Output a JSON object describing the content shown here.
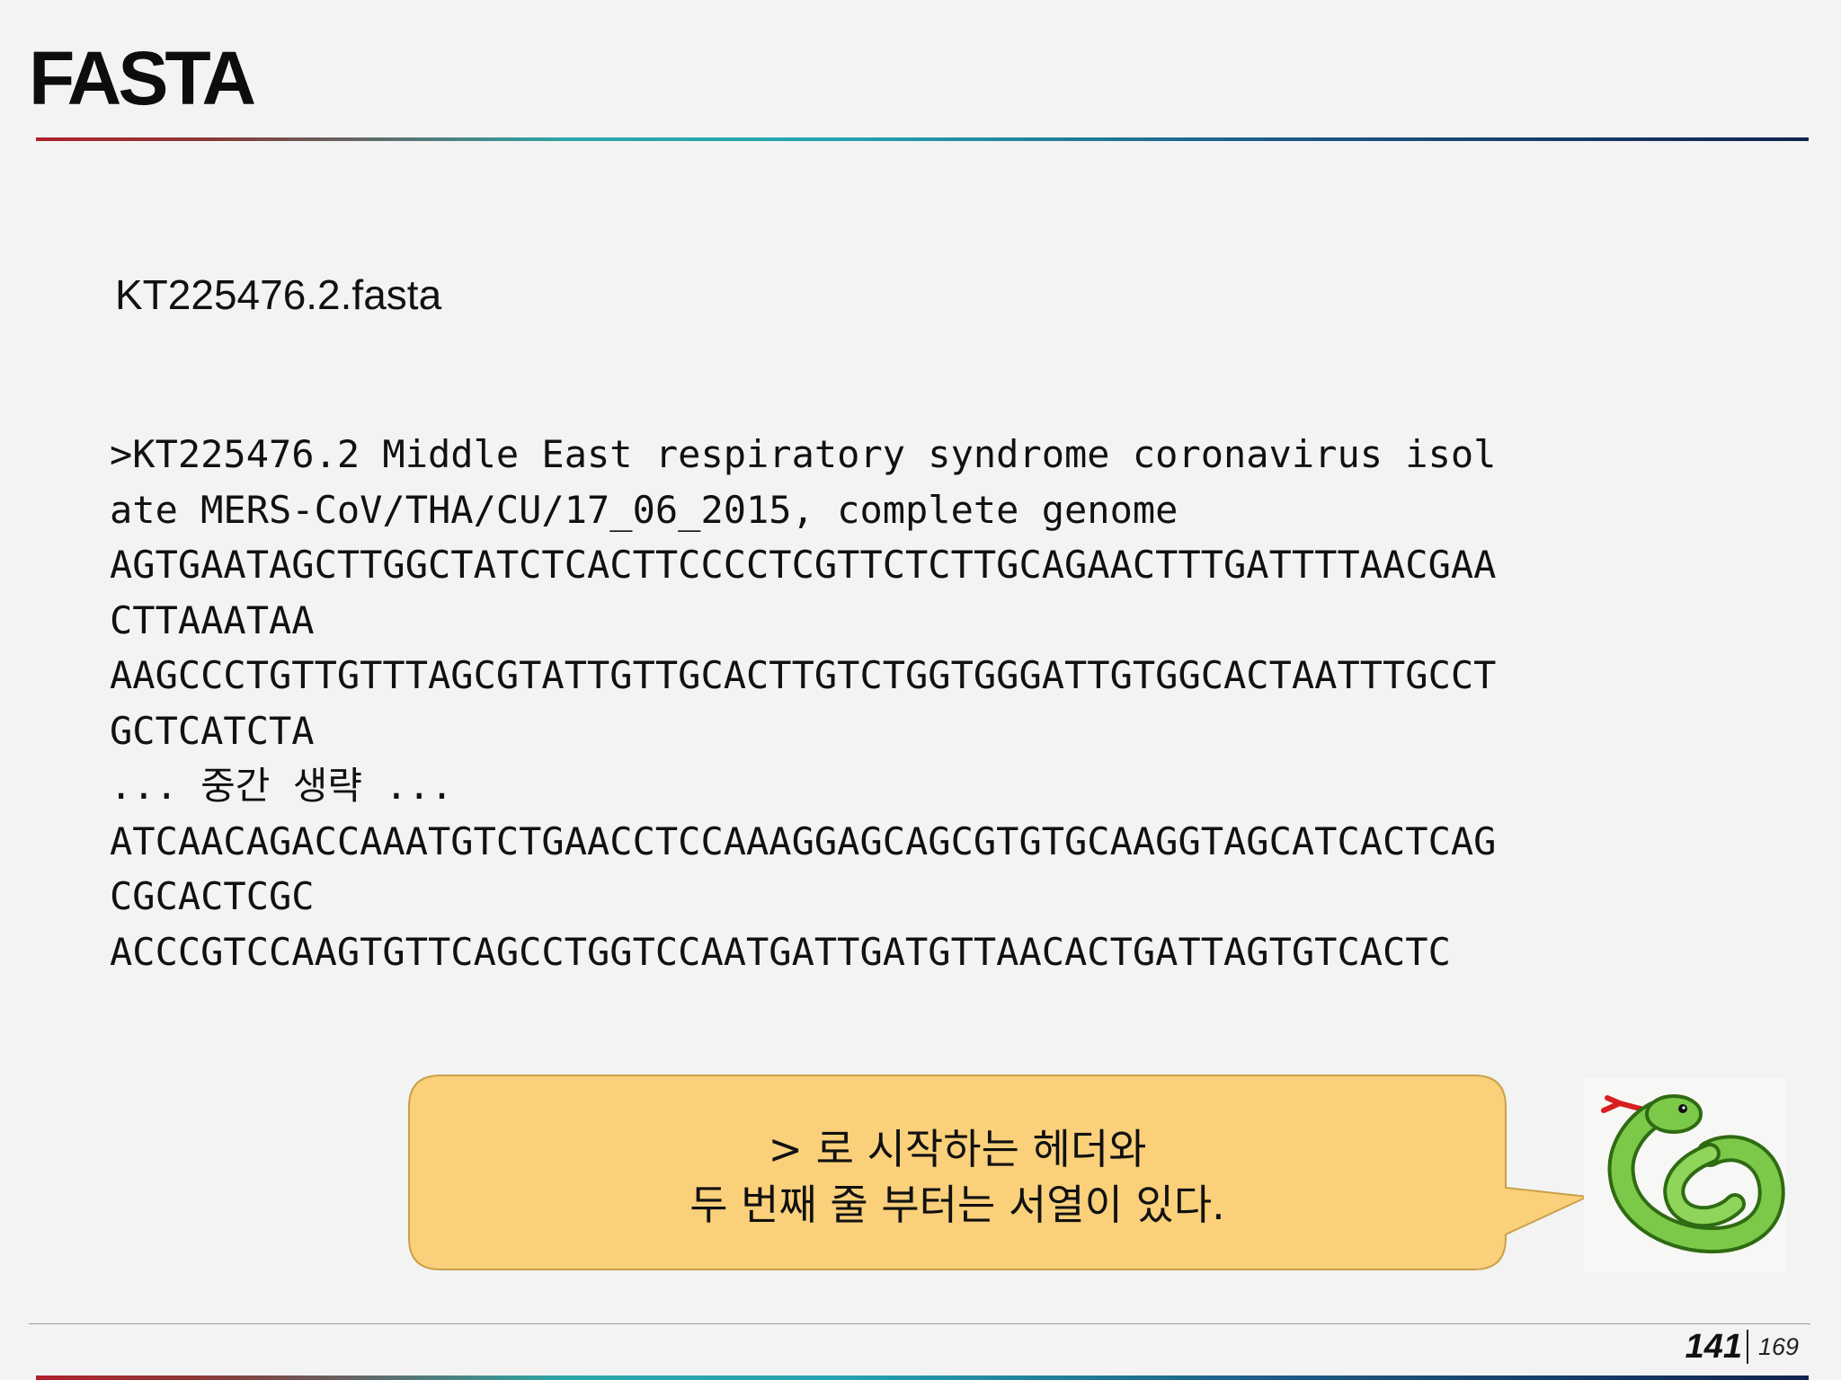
{
  "slide": {
    "title": "FASTA",
    "filename": "KT225476.2.fasta",
    "fasta_lines": [
      ">KT225476.2 Middle East respiratory syndrome coronavirus isol",
      "ate MERS-CoV/THA/CU/17_06_2015, complete genome",
      "AGTGAATAGCTTGGCTATCTCACTTCCCCTCGTTCTCTTGCAGAACTTTGATTTTAACGAA",
      "CTTAAATAA",
      "AAGCCCTGTTGTTTAGCGTATTGTTGCACTTGTCTGGTGGGATTGTGGCACTAATTTGCCT",
      "GCTCATCTA",
      "... 중간 생략 ...",
      "ATCAACAGACCAAATGTCTGAACCTCCAAAGGAGCAGCGTGTGCAAGGTAGCATCACTCAG",
      "CGCACTCGC",
      "ACCCGTCCAAGTGTTCAGCCTGGTCCAATGATTGATGTTAACACTGATTAGTGTCACTC"
    ],
    "callout": {
      "line1": "> 로 시작하는 헤더와",
      "line2": "두 번째 줄 부터는 서열이 있다.",
      "fill_color": "#fad07a",
      "border_color": "#c9a14a"
    },
    "mascot_icon": "green-snake-icon",
    "page_number": "141",
    "page_total": "169"
  },
  "colors": {
    "accent_red": "#b0212b",
    "accent_teal": "#2aa7a8",
    "accent_navy": "#10234f"
  }
}
